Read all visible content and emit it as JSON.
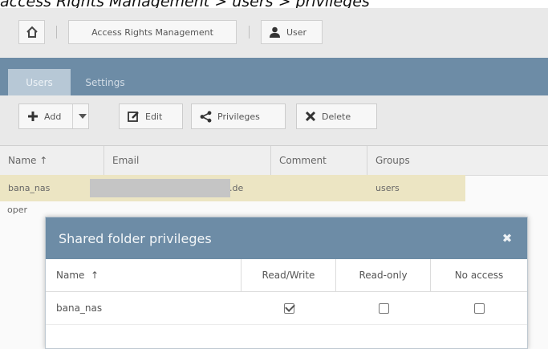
{
  "caption": "access Rights Management  >  users  >  privileges",
  "breadcrumb": {
    "home_icon": "home-icon",
    "section": "Access Rights Management",
    "page": "User",
    "page_icon": "user-icon"
  },
  "tabs": [
    {
      "label": "Users",
      "active": true
    },
    {
      "label": "Settings",
      "active": false
    }
  ],
  "toolbar": {
    "add": "Add",
    "edit": "Edit",
    "privileges": "Privileges",
    "delete": "Delete"
  },
  "table": {
    "columns": [
      "Name",
      "Email",
      "Comment",
      "Groups"
    ],
    "sort_indicator": "↑",
    "rows": [
      {
        "name": "bana_nas",
        "email": ".de",
        "comment": "",
        "groups": "users",
        "selected": true
      },
      {
        "name": "oper",
        "email": "",
        "comment": "",
        "groups": "",
        "selected": false
      }
    ]
  },
  "modal": {
    "title": "Shared folder privileges",
    "close": "✖",
    "columns": [
      "Name",
      "Read/Write",
      "Read-only",
      "No access"
    ],
    "rows": [
      {
        "name": "bana_nas",
        "read_write": true,
        "read_only": false,
        "no_access": false
      }
    ]
  },
  "colors": {
    "header_blue": "#6d8ca6",
    "selected_row": "#ece5c3"
  }
}
